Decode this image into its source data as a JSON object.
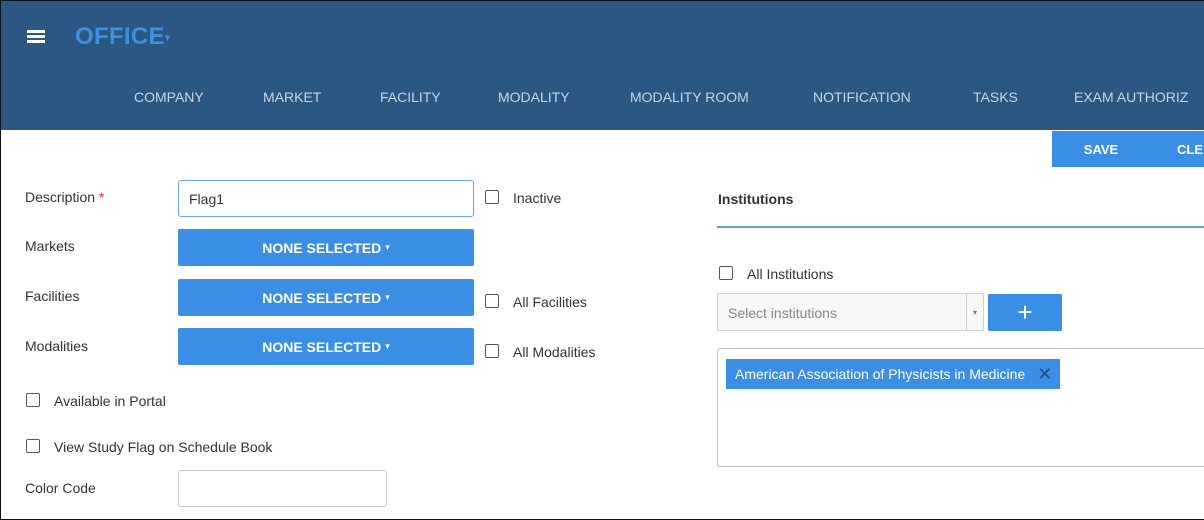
{
  "app": {
    "title": "OFFICE",
    "title_caret": "▾"
  },
  "nav": {
    "items": [
      {
        "label": "COMPANY"
      },
      {
        "label": "MARKET"
      },
      {
        "label": "FACILITY"
      },
      {
        "label": "MODALITY"
      },
      {
        "label": "MODALITY ROOM"
      },
      {
        "label": "NOTIFICATION"
      },
      {
        "label": "TASKS"
      },
      {
        "label": "EXAM AUTHORIZ"
      }
    ]
  },
  "toolbar": {
    "save_label": "SAVE",
    "clear_label": "CLE"
  },
  "form": {
    "description_label": "Description",
    "required_mark": "*",
    "description_value": "Flag1",
    "inactive_label": "Inactive",
    "markets_label": "Markets",
    "markets_value": "NONE SELECTED",
    "facilities_label": "Facilities",
    "facilities_value": "NONE SELECTED",
    "all_facilities_label": "All Facilities",
    "modalities_label": "Modalities",
    "modalities_value": "NONE SELECTED",
    "all_modalities_label": "All Modalities",
    "available_portal_label": "Available in Portal",
    "view_flag_label": "View Study Flag on Schedule Book",
    "color_code_label": "Color Code",
    "color_code_value": "",
    "dropdown_caret": "▾"
  },
  "institutions": {
    "title": "Institutions",
    "all_label": "All Institutions",
    "select_placeholder": "Select institutions",
    "select_arrow": "▾",
    "add_label": "+",
    "selected": [
      {
        "label": "American Association of Physicists in Medicine"
      }
    ],
    "remove_glyph": "✕"
  },
  "colors": {
    "header_bg": "#2b5882",
    "accent": "#3a8ee6",
    "title": "#3d8fe0",
    "nav_text": "#c6d5e4"
  }
}
